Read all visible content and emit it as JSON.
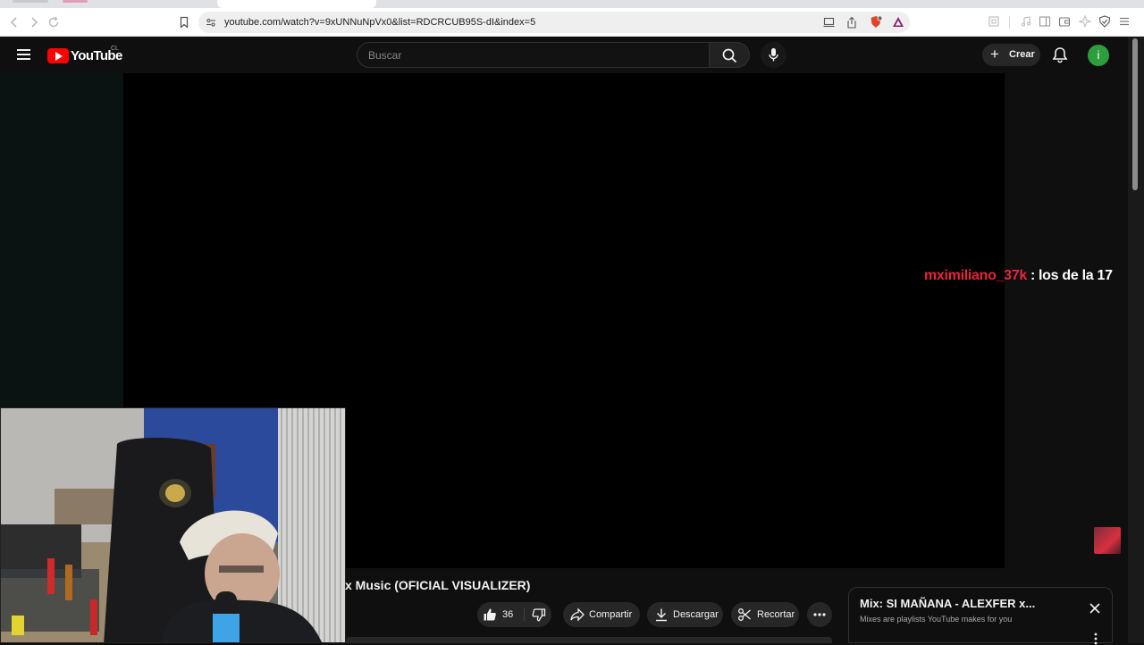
{
  "browser": {
    "url": "youtube.com/watch?v=9xUNNuNpVx0&list=RDCRCUB95S-dI&index=5"
  },
  "header": {
    "logo_text": "YouTube",
    "country_code": "CL",
    "search_placeholder": "Buscar",
    "create_label": "Crear",
    "avatar_letter": "i"
  },
  "stream_overlay": {
    "chat_user": "mximiliano_37k",
    "chat_separator": ":",
    "chat_message": "los de la 17"
  },
  "video": {
    "title": "x Music (OFICIAL VISUALIZER)",
    "like_count": "36",
    "share_label": "Compartir",
    "download_label": "Descargar",
    "clip_label": "Recortar"
  },
  "playlist": {
    "title": "Mix: SI MAÑANA - ALEXFER x...",
    "subtitle": "Mixes are playlists YouTube makes for you"
  },
  "colors": {
    "youtube_red": "#ff0000",
    "chat_user": "#e8243d",
    "avatar_bg": "#2e9e3d"
  }
}
